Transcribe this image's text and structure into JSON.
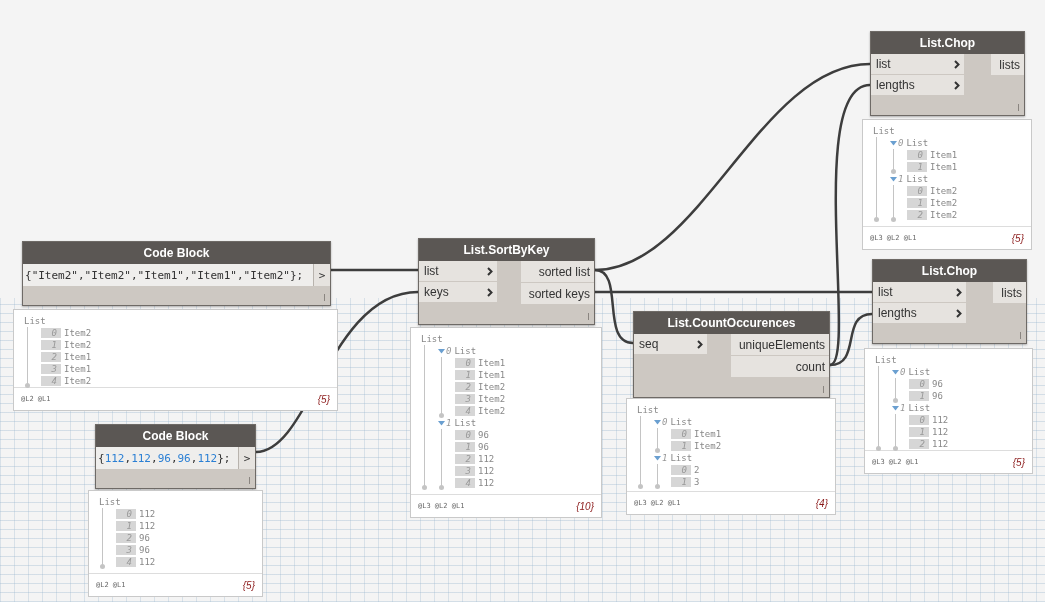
{
  "nodes": [
    {
      "kind": "code",
      "title": "Code Block",
      "code": "{\"Item2\",\"Item2\",\"Item1\",\"Item1\",\"Item2\"};",
      "outputs": [
        ">"
      ],
      "preview": {
        "label": "List",
        "children": [
          {
            "index": "0",
            "value": "Item2"
          },
          {
            "index": "1",
            "value": "Item2"
          },
          {
            "index": "2",
            "value": "Item1"
          },
          {
            "index": "3",
            "value": "Item1"
          },
          {
            "index": "4",
            "value": "Item2"
          }
        ],
        "levels": "@L2 @L1",
        "count": "{5}"
      }
    },
    {
      "kind": "code",
      "title": "Code Block",
      "code": "{112,112,96,96,112};",
      "outputs": [
        ">"
      ],
      "preview": {
        "label": "List",
        "children": [
          {
            "index": "0",
            "value": "112"
          },
          {
            "index": "1",
            "value": "112"
          },
          {
            "index": "2",
            "value": "96"
          },
          {
            "index": "3",
            "value": "96"
          },
          {
            "index": "4",
            "value": "112"
          }
        ],
        "levels": "@L2 @L1",
        "count": "{5}"
      }
    },
    {
      "kind": "function",
      "title": "List.SortByKey",
      "inputs": [
        "list",
        "keys"
      ],
      "outputs": [
        "sorted list",
        "sorted keys"
      ],
      "preview": {
        "label": "List",
        "children": [
          {
            "index": "0",
            "label": "List",
            "expanded": true,
            "children": [
              {
                "index": "0",
                "value": "Item1"
              },
              {
                "index": "1",
                "value": "Item1"
              },
              {
                "index": "2",
                "value": "Item2"
              },
              {
                "index": "3",
                "value": "Item2"
              },
              {
                "index": "4",
                "value": "Item2"
              }
            ]
          },
          {
            "index": "1",
            "label": "List",
            "expanded": true,
            "children": [
              {
                "index": "0",
                "value": "96"
              },
              {
                "index": "1",
                "value": "96"
              },
              {
                "index": "2",
                "value": "112"
              },
              {
                "index": "3",
                "value": "112"
              },
              {
                "index": "4",
                "value": "112"
              }
            ]
          }
        ],
        "levels": "@L3 @L2 @L1",
        "count": "{10}"
      }
    },
    {
      "kind": "function",
      "title": "List.CountOccurences",
      "inputs": [
        "seq"
      ],
      "outputs": [
        "uniqueElements",
        "count"
      ],
      "preview": {
        "label": "List",
        "children": [
          {
            "index": "0",
            "label": "List",
            "expanded": true,
            "children": [
              {
                "index": "0",
                "value": "Item1"
              },
              {
                "index": "1",
                "value": "Item2"
              }
            ]
          },
          {
            "index": "1",
            "label": "List",
            "expanded": true,
            "children": [
              {
                "index": "0",
                "value": "2"
              },
              {
                "index": "1",
                "value": "3"
              }
            ]
          }
        ],
        "levels": "@L3 @L2 @L1",
        "count": "{4}"
      }
    },
    {
      "kind": "function",
      "title": "List.Chop",
      "inputs": [
        "list",
        "lengths"
      ],
      "outputs": [
        "lists"
      ],
      "preview": {
        "label": "List",
        "children": [
          {
            "index": "0",
            "label": "List",
            "expanded": true,
            "children": [
              {
                "index": "0",
                "value": "Item1"
              },
              {
                "index": "1",
                "value": "Item1"
              }
            ]
          },
          {
            "index": "1",
            "label": "List",
            "expanded": true,
            "children": [
              {
                "index": "0",
                "value": "Item2"
              },
              {
                "index": "1",
                "value": "Item2"
              },
              {
                "index": "2",
                "value": "Item2"
              }
            ]
          }
        ],
        "levels": "@L3 @L2 @L1",
        "count": "{5}"
      }
    },
    {
      "kind": "function",
      "title": "List.Chop",
      "inputs": [
        "list",
        "lengths"
      ],
      "outputs": [
        "lists"
      ],
      "preview": {
        "label": "List",
        "children": [
          {
            "index": "0",
            "label": "List",
            "expanded": true,
            "children": [
              {
                "index": "0",
                "value": "96"
              },
              {
                "index": "1",
                "value": "96"
              }
            ]
          },
          {
            "index": "1",
            "label": "List",
            "expanded": true,
            "children": [
              {
                "index": "0",
                "value": "112"
              },
              {
                "index": "1",
                "value": "112"
              },
              {
                "index": "2",
                "value": "112"
              }
            ]
          }
        ],
        "levels": "@L3 @L2 @L1",
        "count": "{5}"
      }
    }
  ]
}
